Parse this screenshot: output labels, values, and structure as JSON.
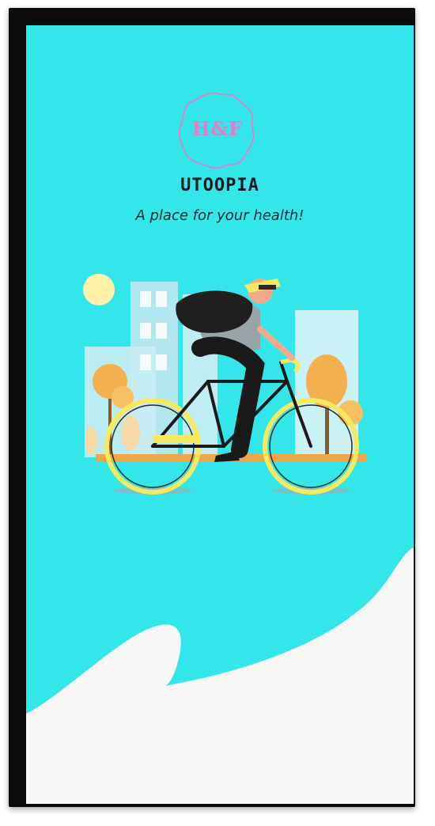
{
  "splash": {
    "logo_text": "H&F",
    "app_name": "UTOOPIA",
    "tagline": "A place for your health!"
  },
  "colors": {
    "background": "#33e6ea",
    "wave": "#f7f7f7",
    "logo_accent": "#ef78c2",
    "title": "#0f1a1f"
  },
  "icons": {
    "logo": "hf-badge-icon",
    "illustration": "cyclist-illustration"
  }
}
